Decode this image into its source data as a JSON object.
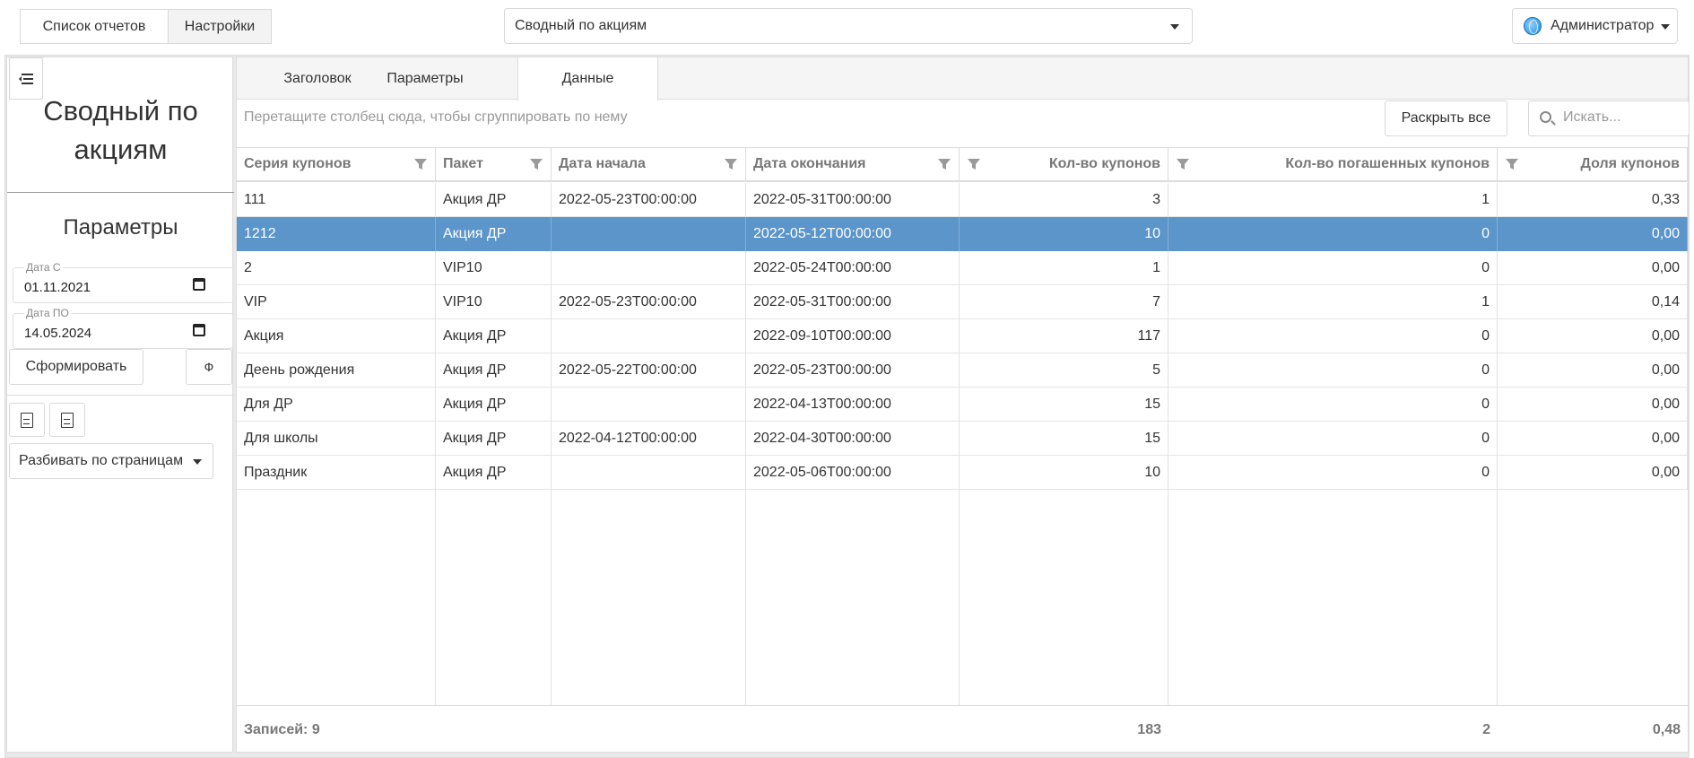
{
  "topbar": {
    "nav_reports": "Список отчетов",
    "nav_settings": "Настройки",
    "report_selected": "Сводный по акциям",
    "user": "Администратор"
  },
  "sidebar": {
    "title": "Сводный по акциям",
    "params_title": "Параметры",
    "date_from_label": "Дата С",
    "date_from_value": "01.11.2021",
    "date_to_label": "Дата ПО",
    "date_to_value": "14.05.2024",
    "form_button": "Сформировать",
    "phi_button": "Ф",
    "export_xlsx_icon": "xlsx-file-icon",
    "export_doc_icon": "document-icon",
    "paging": "Разбивать по страницам"
  },
  "tabs": [
    {
      "label": "Заголовок",
      "active": false
    },
    {
      "label": "Параметры",
      "active": false
    },
    {
      "label": "Данные",
      "active": true
    }
  ],
  "toolbar": {
    "group_hint": "Перетащите столбец сюда, чтобы сгруппировать по нему",
    "expand_all": "Раскрыть все",
    "search_placeholder": "Искать..."
  },
  "grid": {
    "columns": [
      "Серия купонов",
      "Пакет",
      "Дата начала",
      "Дата окончания",
      "Кол-во купонов",
      "Кол-во погашенных купонов",
      "Доля купонов"
    ],
    "rows": [
      [
        "111",
        "Акция ДР",
        "2022-05-23T00:00:00",
        "2022-05-31T00:00:00",
        "3",
        "1",
        "0,33"
      ],
      [
        "1212",
        "Акция ДР",
        "",
        "2022-05-12T00:00:00",
        "10",
        "0",
        "0,00"
      ],
      [
        "2",
        "VIP10",
        "",
        "2022-05-24T00:00:00",
        "1",
        "0",
        "0,00"
      ],
      [
        "VIP",
        "VIP10",
        "2022-05-23T00:00:00",
        "2022-05-31T00:00:00",
        "7",
        "1",
        "0,14"
      ],
      [
        "Акция",
        "Акция ДР",
        "",
        "2022-09-10T00:00:00",
        "117",
        "0",
        "0,00"
      ],
      [
        "Деень рождения",
        "Акция ДР",
        "2022-05-22T00:00:00",
        "2022-05-23T00:00:00",
        "5",
        "0",
        "0,00"
      ],
      [
        "Для ДР",
        "Акция ДР",
        "",
        "2022-04-13T00:00:00",
        "15",
        "0",
        "0,00"
      ],
      [
        "Для школы",
        "Акция ДР",
        "2022-04-12T00:00:00",
        "2022-04-30T00:00:00",
        "15",
        "0",
        "0,00"
      ],
      [
        "Праздник",
        "Акция ДР",
        "",
        "2022-05-06T00:00:00",
        "10",
        "0",
        "0,00"
      ]
    ],
    "selected_row": 1,
    "footer": {
      "records": "Записей: 9",
      "total_coupons": "183",
      "total_redeemed": "2",
      "total_share": "0,48"
    },
    "selection_color": "#5b95c9"
  }
}
